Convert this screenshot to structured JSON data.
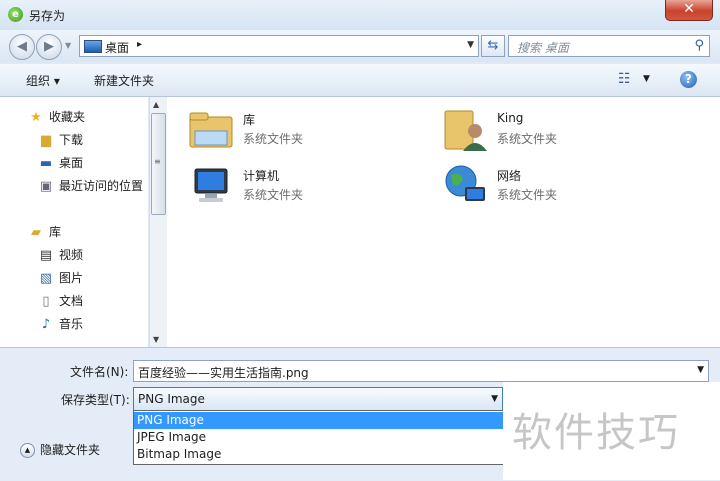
{
  "window": {
    "title": "另存为",
    "close_glyph": "✕"
  },
  "nav": {
    "address": {
      "location": "桌面",
      "separator": "▸"
    },
    "search": {
      "placeholder": "搜索 桌面"
    }
  },
  "toolbar": {
    "organize": "组织 ▾",
    "new_folder": "新建文件夹"
  },
  "sidebar": {
    "favorites": [
      {
        "label": "收藏夹",
        "icon": "star-icon"
      },
      {
        "label": "下载",
        "icon": "download-folder-icon"
      },
      {
        "label": "桌面",
        "icon": "desktop-icon"
      },
      {
        "label": "最近访问的位置",
        "icon": "recent-places-icon"
      }
    ],
    "libraries": [
      {
        "label": "库",
        "icon": "library-icon"
      },
      {
        "label": "视频",
        "icon": "video-icon"
      },
      {
        "label": "图片",
        "icon": "picture-icon"
      },
      {
        "label": "文档",
        "icon": "document-icon"
      },
      {
        "label": "音乐",
        "icon": "music-icon"
      }
    ]
  },
  "content": {
    "items": [
      {
        "name": "库",
        "type": "系统文件夹",
        "icon": "library-icon"
      },
      {
        "name": "King",
        "type": "系统文件夹",
        "icon": "user-folder-icon"
      },
      {
        "name": "计算机",
        "type": "系统文件夹",
        "icon": "computer-icon"
      },
      {
        "name": "网络",
        "type": "系统文件夹",
        "icon": "network-icon"
      }
    ]
  },
  "form": {
    "filename_label": "文件名(N):",
    "filename_value": "百度经验——实用生活指南.png",
    "filetype_label": "保存类型(T):",
    "filetype_value": "PNG Image",
    "filetype_options": [
      "PNG Image",
      "JPEG Image",
      "Bitmap Image"
    ],
    "hide_folders": "隐藏文件夹"
  },
  "watermark": "软件技巧"
}
